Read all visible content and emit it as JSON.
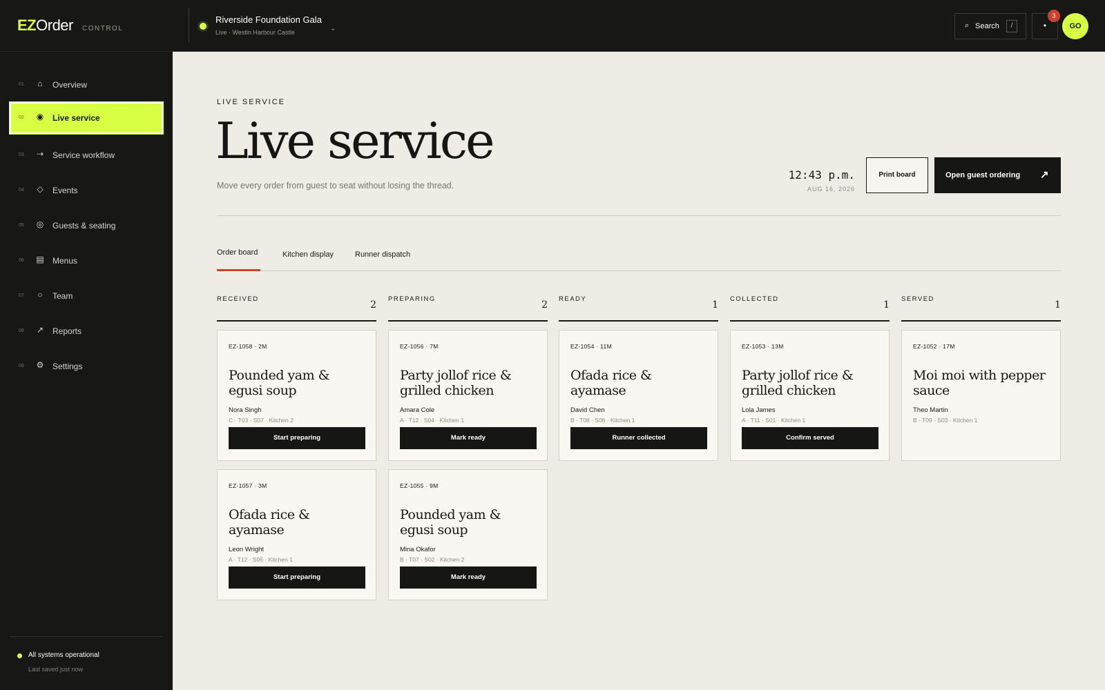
{
  "app": {
    "logo_ez": "EZ",
    "logo_order": "Order",
    "logo_control": "CONTROL"
  },
  "event": {
    "title": "Riverside Foundation Gala",
    "subtitle": "Live · Westin Harbour Castle",
    "chevron": "⌄"
  },
  "topbar": {
    "search_icon": "⌕",
    "search_label": "Search",
    "search_kbd": "/",
    "notif_icon": "•",
    "notif_count": "3",
    "avatar_initials": "GO"
  },
  "sidebar": {
    "items": [
      {
        "num": "01",
        "icon": "⌂",
        "label": "Overview"
      },
      {
        "num": "02",
        "icon": "◉",
        "label": "Live service"
      },
      {
        "num": "03",
        "icon": "⇢",
        "label": "Service workflow"
      },
      {
        "num": "04",
        "icon": "◇",
        "label": "Events"
      },
      {
        "num": "05",
        "icon": "◎",
        "label": "Guests & seating"
      },
      {
        "num": "06",
        "icon": "▤",
        "label": "Menus"
      },
      {
        "num": "07",
        "icon": "○",
        "label": "Team"
      },
      {
        "num": "08",
        "icon": "↗",
        "label": "Reports"
      },
      {
        "num": "09",
        "icon": "⚙",
        "label": "Settings"
      }
    ],
    "status_text": "All systems operational",
    "status_sub": "Last saved just now"
  },
  "header": {
    "eyebrow": "LIVE SERVICE",
    "title": "Live service",
    "subtitle": "Move every order from guest to seat without losing the thread.",
    "clock": "12:43 p.m.",
    "date": "AUG 16, 2026",
    "print_label": "Print board",
    "open_label": "Open guest ordering",
    "open_arrow": "↗"
  },
  "tabs": [
    {
      "label": "Order board"
    },
    {
      "label": "Kitchen display"
    },
    {
      "label": "Runner dispatch"
    }
  ],
  "columns": [
    {
      "title": "RECEIVED",
      "count": "2"
    },
    {
      "title": "PREPARING",
      "count": "2"
    },
    {
      "title": "READY",
      "count": "1"
    },
    {
      "title": "COLLECTED",
      "count": "1"
    },
    {
      "title": "SERVED",
      "count": "1"
    }
  ],
  "cards": [
    {
      "id": "EZ-1058 · 2M",
      "dish": "Pounded yam & egusi soup",
      "guest": "Nora Singh",
      "meta": "C · T03 · S07 · Kitchen 2",
      "action": "Start preparing"
    },
    {
      "id": "EZ-1056 · 7M",
      "dish": "Party jollof rice & grilled chicken",
      "guest": "Amara Cole",
      "meta": "A · T12 · S04 · Kitchen 1",
      "action": "Mark ready"
    },
    {
      "id": "EZ-1054 · 11M",
      "dish": "Ofada rice & ayamase",
      "guest": "David Chen",
      "meta": "B · T08 · S06 · Kitchen 1",
      "action": "Runner collected"
    },
    {
      "id": "EZ-1053 · 13M",
      "dish": "Party jollof rice & grilled chicken",
      "guest": "Lola James",
      "meta": "A · T11 · S01 · Kitchen 1",
      "action": "Confirm served"
    },
    {
      "id": "EZ-1052 · 17M",
      "dish": "Moi moi with pepper sauce",
      "guest": "Theo Martin",
      "meta": "B · T09 · S03 · Kitchen 1"
    },
    {
      "id": "EZ-1057 · 3M",
      "dish": "Ofada rice & ayamase",
      "guest": "Leon Wright",
      "meta": "A · T12 · S05 · Kitchen 1",
      "action": "Start preparing"
    },
    {
      "id": "EZ-1055 · 9M",
      "dish": "Pounded yam & egusi soup",
      "guest": "Mina Okafor",
      "meta": "B · T07 · S02 · Kitchen 2",
      "action": "Mark ready"
    }
  ],
  "colors": {
    "accent": "#d8ff43",
    "dark": "#171815",
    "background": "#efece6",
    "tab_underline": "#c9432e",
    "badge": "#c9432e"
  }
}
